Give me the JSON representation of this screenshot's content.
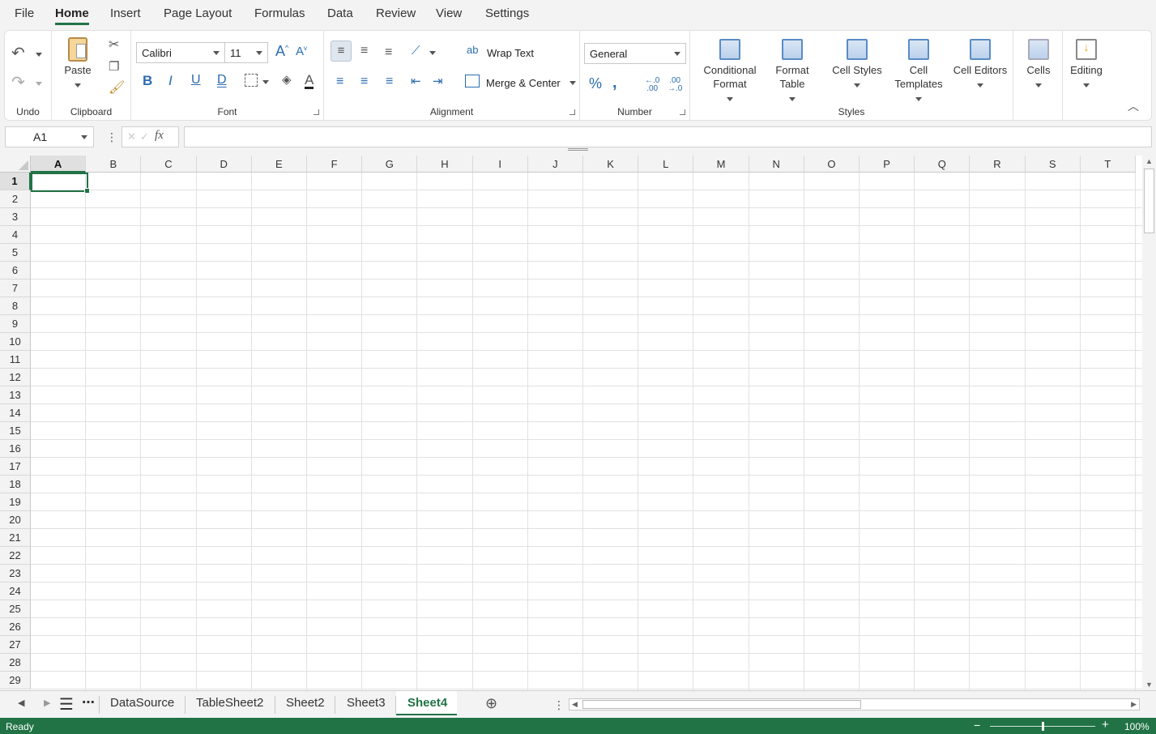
{
  "menu": {
    "tabs": [
      "File",
      "Home",
      "Insert",
      "Page Layout",
      "Formulas",
      "Data",
      "Review",
      "View",
      "Settings"
    ],
    "active": "Home"
  },
  "ribbon": {
    "undo_group": "Undo",
    "clipboard": {
      "label": "Clipboard",
      "paste": "Paste"
    },
    "font": {
      "label": "Font",
      "family": "Calibri",
      "size": "11"
    },
    "alignment": {
      "label": "Alignment",
      "wrap_text": "Wrap Text",
      "merge_center": "Merge & Center"
    },
    "number": {
      "label": "Number",
      "format": "General"
    },
    "styles": {
      "label": "Styles",
      "conditional_format_1": "Conditional",
      "conditional_format_2": "Format",
      "format_table_1": "Format",
      "format_table_2": "Table",
      "cell_styles": "Cell Styles",
      "cell_templates_1": "Cell",
      "cell_templates_2": "Templates",
      "cell_editors": "Cell Editors"
    },
    "cells": "Cells",
    "editing": "Editing"
  },
  "formula_bar": {
    "name_box": "A1",
    "fx": "fx",
    "formula": ""
  },
  "grid": {
    "columns": [
      "A",
      "B",
      "C",
      "D",
      "E",
      "F",
      "G",
      "H",
      "I",
      "J",
      "K",
      "L",
      "M",
      "N",
      "O",
      "P",
      "Q",
      "R",
      "S",
      "T"
    ],
    "rows": [
      "1",
      "2",
      "3",
      "4",
      "5",
      "6",
      "7",
      "8",
      "9",
      "10",
      "11",
      "12",
      "13",
      "14",
      "15",
      "16",
      "17",
      "18",
      "19",
      "20",
      "21",
      "22",
      "23",
      "24",
      "25",
      "26",
      "27",
      "28",
      "29"
    ],
    "selected_cell": "A1"
  },
  "sheets": {
    "tabs": [
      "DataSource",
      "TableSheet2",
      "Sheet2",
      "Sheet3",
      "Sheet4"
    ],
    "active": "Sheet4"
  },
  "status": {
    "text": "Ready",
    "zoom": "100%",
    "zoom_fraction": 0.5
  },
  "colors": {
    "accent": "#217346"
  }
}
